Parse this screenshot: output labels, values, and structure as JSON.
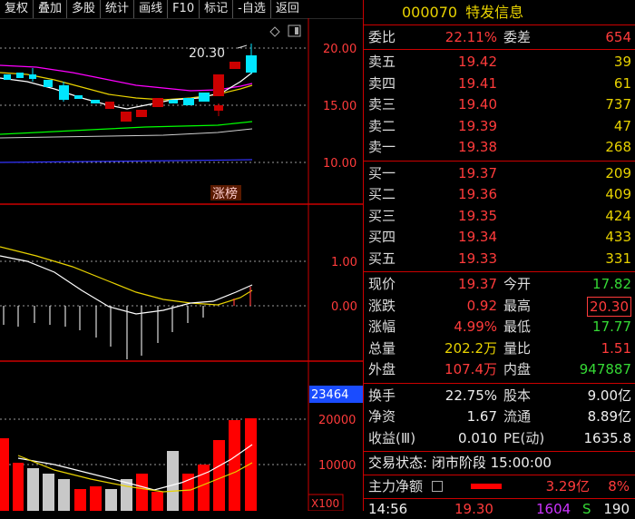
{
  "toolbar": {
    "buttons": [
      "复权",
      "叠加",
      "多股",
      "统计",
      "画线",
      "F10",
      "标记",
      "-自选",
      "返回"
    ]
  },
  "chart": {
    "price_label": "20.30",
    "tag_label": "涨榜",
    "main_axis": [
      "20.00",
      "15.00",
      "10.00"
    ],
    "macd_axis": [
      "1.00",
      "0.00"
    ],
    "vol_axis": [
      "23464",
      "20000",
      "10000"
    ],
    "scale_label": "X100"
  },
  "stock": {
    "code": "000070",
    "name": "特发信息"
  },
  "weibi": {
    "label": "委比",
    "value": "22.11%",
    "diff_label": "委差",
    "diff_value": "654"
  },
  "asks": [
    {
      "label": "卖五",
      "price": "19.42",
      "vol": "39"
    },
    {
      "label": "卖四",
      "price": "19.41",
      "vol": "61"
    },
    {
      "label": "卖三",
      "price": "19.40",
      "vol": "737"
    },
    {
      "label": "卖二",
      "price": "19.39",
      "vol": "47"
    },
    {
      "label": "卖一",
      "price": "19.38",
      "vol": "268"
    }
  ],
  "bids": [
    {
      "label": "买一",
      "price": "19.37",
      "vol": "209"
    },
    {
      "label": "买二",
      "price": "19.36",
      "vol": "409"
    },
    {
      "label": "买三",
      "price": "19.35",
      "vol": "424"
    },
    {
      "label": "买四",
      "price": "19.34",
      "vol": "433"
    },
    {
      "label": "买五",
      "price": "19.33",
      "vol": "331"
    }
  ],
  "quote": [
    {
      "l1": "现价",
      "v1": "19.37",
      "l2": "今开",
      "v2": "17.82"
    },
    {
      "l1": "涨跌",
      "v1": "0.92",
      "l2": "最高",
      "v2": "20.30"
    },
    {
      "l1": "涨幅",
      "v1": "4.99%",
      "l2": "最低",
      "v2": "17.77"
    },
    {
      "l1": "总量",
      "v1": "202.2万",
      "l2": "量比",
      "v2": "1.51"
    },
    {
      "l1": "外盘",
      "v1": "107.4万",
      "l2": "内盘",
      "v2": "947887"
    }
  ],
  "stats": [
    {
      "l1": "换手",
      "v1": "22.75%",
      "l2": "股本",
      "v2": "9.00亿"
    },
    {
      "l1": "净资",
      "v1": "1.67",
      "l2": "流通",
      "v2": "8.89亿"
    },
    {
      "l1": "收益(Ⅲ)",
      "v1": "0.010",
      "l2": "PE(动)",
      "v2": "1635.8"
    }
  ],
  "trade_status": "交易状态: 闭市阶段 15:00:00",
  "main_flow": {
    "label": "主力净额",
    "value": "3.29亿",
    "pct": "8%"
  },
  "tick": {
    "time": "14:56",
    "price": "19.30",
    "vol": "1604",
    "side": "S",
    "num": "190"
  },
  "colors": {
    "up": "#ff3b3b",
    "down": "#00e5ff",
    "ma5": "#ffffff",
    "ma10": "#e8d200",
    "ma20": "#ff00ff",
    "ma60": "#00ff00"
  }
}
